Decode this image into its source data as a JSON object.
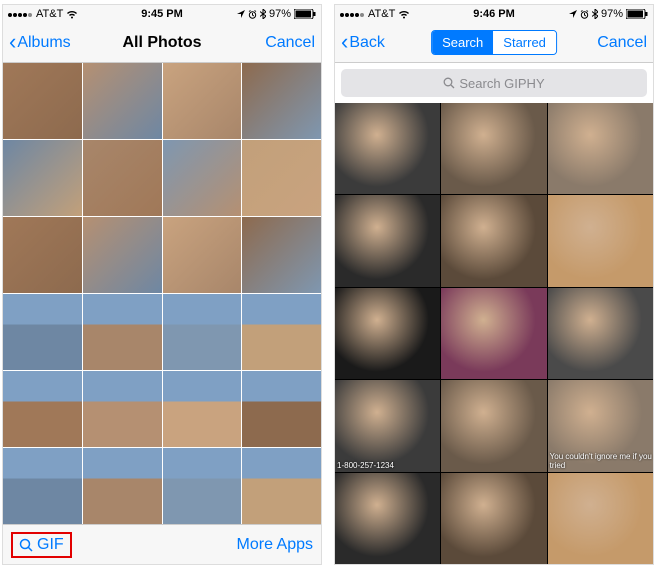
{
  "left": {
    "status": {
      "carrier": "AT&T",
      "time": "9:45 PM",
      "battery": "97%"
    },
    "nav": {
      "back": "Albums",
      "title": "All Photos",
      "right": "Cancel"
    },
    "bottom": {
      "gif": "GIF",
      "more": "More Apps"
    },
    "grid_rows": 6,
    "grid_cols": 4
  },
  "right": {
    "status": {
      "carrier": "AT&T",
      "time": "9:46 PM",
      "battery": "97%"
    },
    "nav": {
      "back": "Back",
      "seg_search": "Search",
      "seg_starred": "Starred",
      "right": "Cancel"
    },
    "search_placeholder": "Search GIPHY",
    "grid_rows": 5,
    "grid_cols": 3,
    "captions": {
      "r3c0": "1-800-257-1234",
      "r3c2": "You couldn't ignore me if you tried"
    }
  }
}
